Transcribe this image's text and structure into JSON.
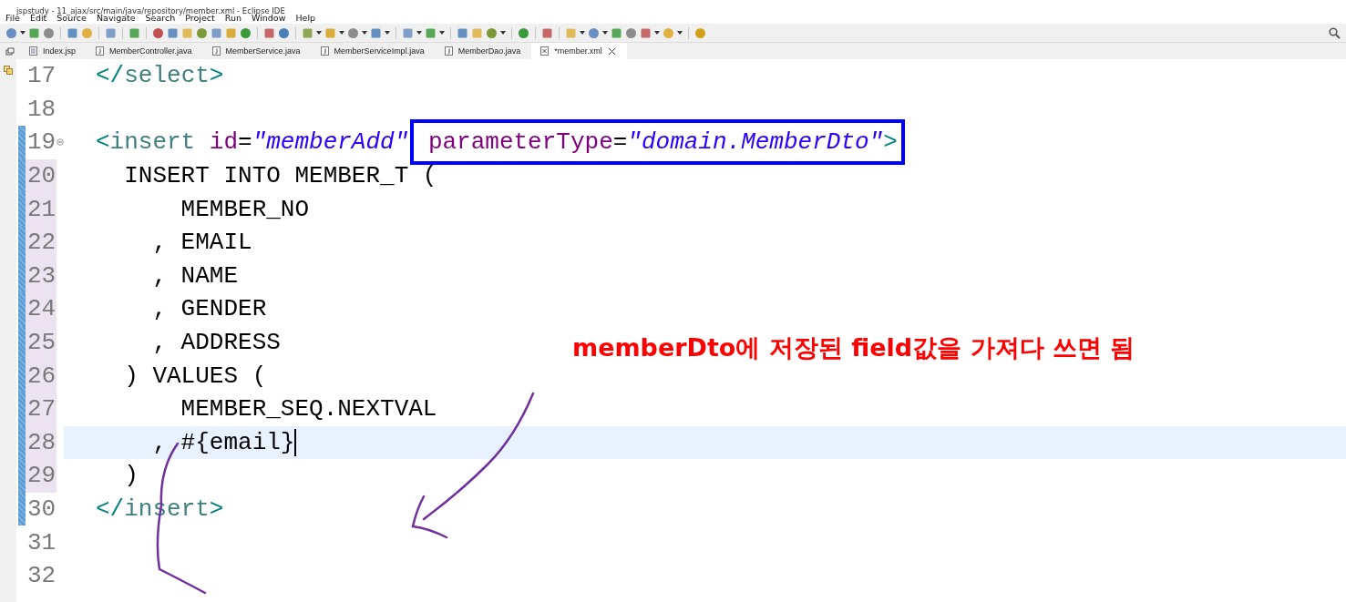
{
  "window": {
    "title": "jspstudy - 11_ajax/src/main/java/repository/member.xml - Eclipse IDE"
  },
  "menu": [
    "File",
    "Edit",
    "Source",
    "Navigate",
    "Search",
    "Project",
    "Run",
    "Window",
    "Help"
  ],
  "tabs": [
    {
      "label": "Index.jsp",
      "kind": "jsp",
      "selected": false
    },
    {
      "label": "MemberController.java",
      "kind": "java",
      "selected": false
    },
    {
      "label": "MemberService.java",
      "kind": "java",
      "selected": false
    },
    {
      "label": "MemberServiceImpl.java",
      "kind": "java",
      "selected": false
    },
    {
      "label": "MemberDao.java",
      "kind": "java",
      "selected": false
    },
    {
      "label": "*member.xml",
      "kind": "xml",
      "selected": true
    }
  ],
  "editor": {
    "lines": [
      {
        "number": "17",
        "changed": false,
        "ranged": false,
        "current": false,
        "foldable": false,
        "parts": [
          {
            "boxed": false,
            "tokens": [
              {
                "kind": "bracket",
                "text": "</"
              },
              {
                "kind": "tag",
                "text": "select"
              },
              {
                "kind": "bracket",
                "text": ">"
              }
            ]
          }
        ]
      },
      {
        "number": "18",
        "changed": false,
        "ranged": false,
        "current": false,
        "foldable": false
      },
      {
        "number": "19",
        "changed": true,
        "ranged": false,
        "current": false,
        "foldable": true,
        "parts": [
          {
            "boxed": false,
            "tokens": [
              {
                "kind": "bracket",
                "text": "<"
              },
              {
                "kind": "tag",
                "text": "insert"
              },
              {
                "kind": "attr",
                "text": " id"
              },
              {
                "kind": "text",
                "text": "="
              },
              {
                "kind": "string",
                "text": "\"memberAdd\""
              }
            ]
          },
          {
            "boxed": true,
            "tokens": [
              {
                "kind": "attr",
                "text": " parameterType"
              },
              {
                "kind": "text",
                "text": "="
              },
              {
                "kind": "string",
                "text": "\"domain.MemberDto\""
              },
              {
                "kind": "bracket",
                "text": ">"
              }
            ]
          }
        ]
      },
      {
        "number": "20",
        "changed": true,
        "ranged": true,
        "current": false,
        "foldable": false,
        "parts": [
          {
            "boxed": false,
            "tokens": [
              {
                "kind": "text",
                "text": "  INSERT INTO MEMBER_T ("
              }
            ]
          }
        ]
      },
      {
        "number": "21",
        "changed": true,
        "ranged": true,
        "current": false,
        "foldable": false,
        "parts": [
          {
            "boxed": false,
            "tokens": [
              {
                "kind": "text",
                "text": "      MEMBER_NO"
              }
            ]
          }
        ]
      },
      {
        "number": "22",
        "changed": true,
        "ranged": true,
        "current": false,
        "foldable": false,
        "parts": [
          {
            "boxed": false,
            "tokens": [
              {
                "kind": "text",
                "text": "    , EMAIL"
              }
            ]
          }
        ]
      },
      {
        "number": "23",
        "changed": true,
        "ranged": true,
        "current": false,
        "foldable": false,
        "parts": [
          {
            "boxed": false,
            "tokens": [
              {
                "kind": "text",
                "text": "    , NAME"
              }
            ]
          }
        ]
      },
      {
        "number": "24",
        "changed": true,
        "ranged": true,
        "current": false,
        "foldable": false,
        "parts": [
          {
            "boxed": false,
            "tokens": [
              {
                "kind": "text",
                "text": "    , GENDER"
              }
            ]
          }
        ]
      },
      {
        "number": "25",
        "changed": true,
        "ranged": true,
        "current": false,
        "foldable": false,
        "parts": [
          {
            "boxed": false,
            "tokens": [
              {
                "kind": "text",
                "text": "    , ADDRESS"
              }
            ]
          }
        ]
      },
      {
        "number": "26",
        "changed": true,
        "ranged": true,
        "current": false,
        "foldable": false,
        "parts": [
          {
            "boxed": false,
            "tokens": [
              {
                "kind": "text",
                "text": "  ) VALUES ("
              }
            ]
          }
        ]
      },
      {
        "number": "27",
        "changed": true,
        "ranged": true,
        "current": false,
        "foldable": false,
        "parts": [
          {
            "boxed": false,
            "tokens": [
              {
                "kind": "text",
                "text": "      MEMBER_SEQ.NEXTVAL"
              }
            ]
          }
        ]
      },
      {
        "number": "28",
        "changed": true,
        "ranged": true,
        "current": true,
        "foldable": false,
        "parts": [
          {
            "boxed": false,
            "tokens": [
              {
                "kind": "text",
                "text": "    , #{email}"
              }
            ]
          }
        ]
      },
      {
        "number": "29",
        "changed": true,
        "ranged": true,
        "current": false,
        "foldable": false,
        "parts": [
          {
            "boxed": false,
            "tokens": [
              {
                "kind": "text",
                "text": "  )"
              }
            ]
          }
        ]
      },
      {
        "number": "30",
        "changed": true,
        "ranged": false,
        "current": false,
        "foldable": false,
        "parts": [
          {
            "boxed": false,
            "tokens": [
              {
                "kind": "bracket",
                "text": "</"
              },
              {
                "kind": "tag",
                "text": "insert"
              },
              {
                "kind": "bracket",
                "text": ">"
              }
            ]
          }
        ]
      },
      {
        "number": "31",
        "changed": false,
        "ranged": false,
        "current": false,
        "foldable": false
      },
      {
        "number": "32",
        "changed": false,
        "ranged": false,
        "current": false,
        "foldable": false
      }
    ]
  },
  "annotation": {
    "text": "memberDto에 저장된 field값을 가져다 쓰면 됨"
  }
}
